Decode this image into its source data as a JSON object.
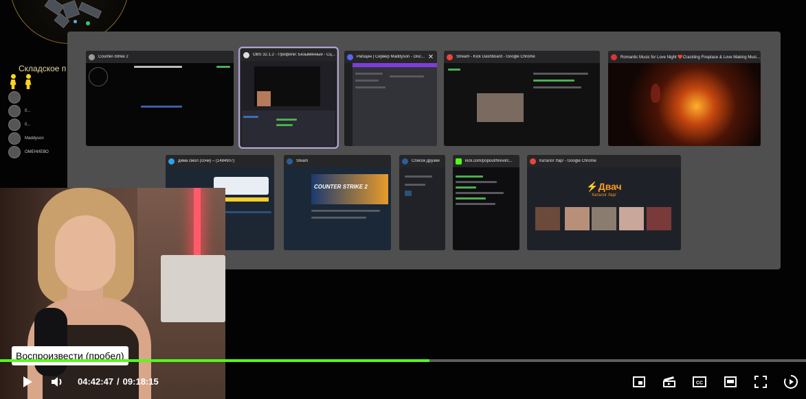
{
  "hud": {
    "location_label": "Складское п",
    "players": [
      "",
      "0...",
      "0...",
      "Maddyson",
      "ОМЕНИЕВО"
    ]
  },
  "windows": [
    {
      "title": "Counter-Strike 2",
      "icon_color": "#9a9a9a"
    },
    {
      "title": "OBS 32.1.2 - Профили: Безымянный - Сц...",
      "icon_color": "#dddddd"
    },
    {
      "title": "Рабщен | Сервер Maddyson - Disc...",
      "icon_color": "#5865f2"
    },
    {
      "title": "Stream - Kick Dashboard - Google Chrome",
      "icon_color": "#e8453c"
    },
    {
      "title": "Romantic Music for Love Night ❤️Crackling Fireplace & Love Making Music...",
      "icon_color": "#d33"
    },
    {
      "title": "дима смол (сочи) – (1484907)",
      "icon_color": "#2aa3ef"
    },
    {
      "title": "Steam",
      "icon_color": "#2a5e9b"
    },
    {
      "title": "Список друзей",
      "icon_color": "#2a5e9b"
    },
    {
      "title": "kick.com/popout/firevil/c...",
      "icon_color": "#53fc18"
    },
    {
      "title": "Каталог /fap/ - Google Chrome",
      "icon_color": "#e8453c"
    }
  ],
  "window_content": {
    "steam_banner_text": "COUNTER STRIKE 2",
    "dvach_logo": "⚡Двач",
    "dvach_sub": "Каталог /fap/"
  },
  "player": {
    "tooltip": "Воспроизвести (пробел)",
    "current_time": "04:42:47",
    "separator": "/",
    "duration": "09:18:15",
    "progress_fraction": 0.533,
    "accent": "#53fc18"
  },
  "icons": {
    "play": "play-icon",
    "volume": "volume-icon",
    "pip": "picture-in-picture-icon",
    "clip": "clip-icon",
    "cc": "closed-captions-icon",
    "theater": "theater-mode-icon",
    "fullscreen": "fullscreen-icon",
    "speed": "playback-speed-icon"
  }
}
